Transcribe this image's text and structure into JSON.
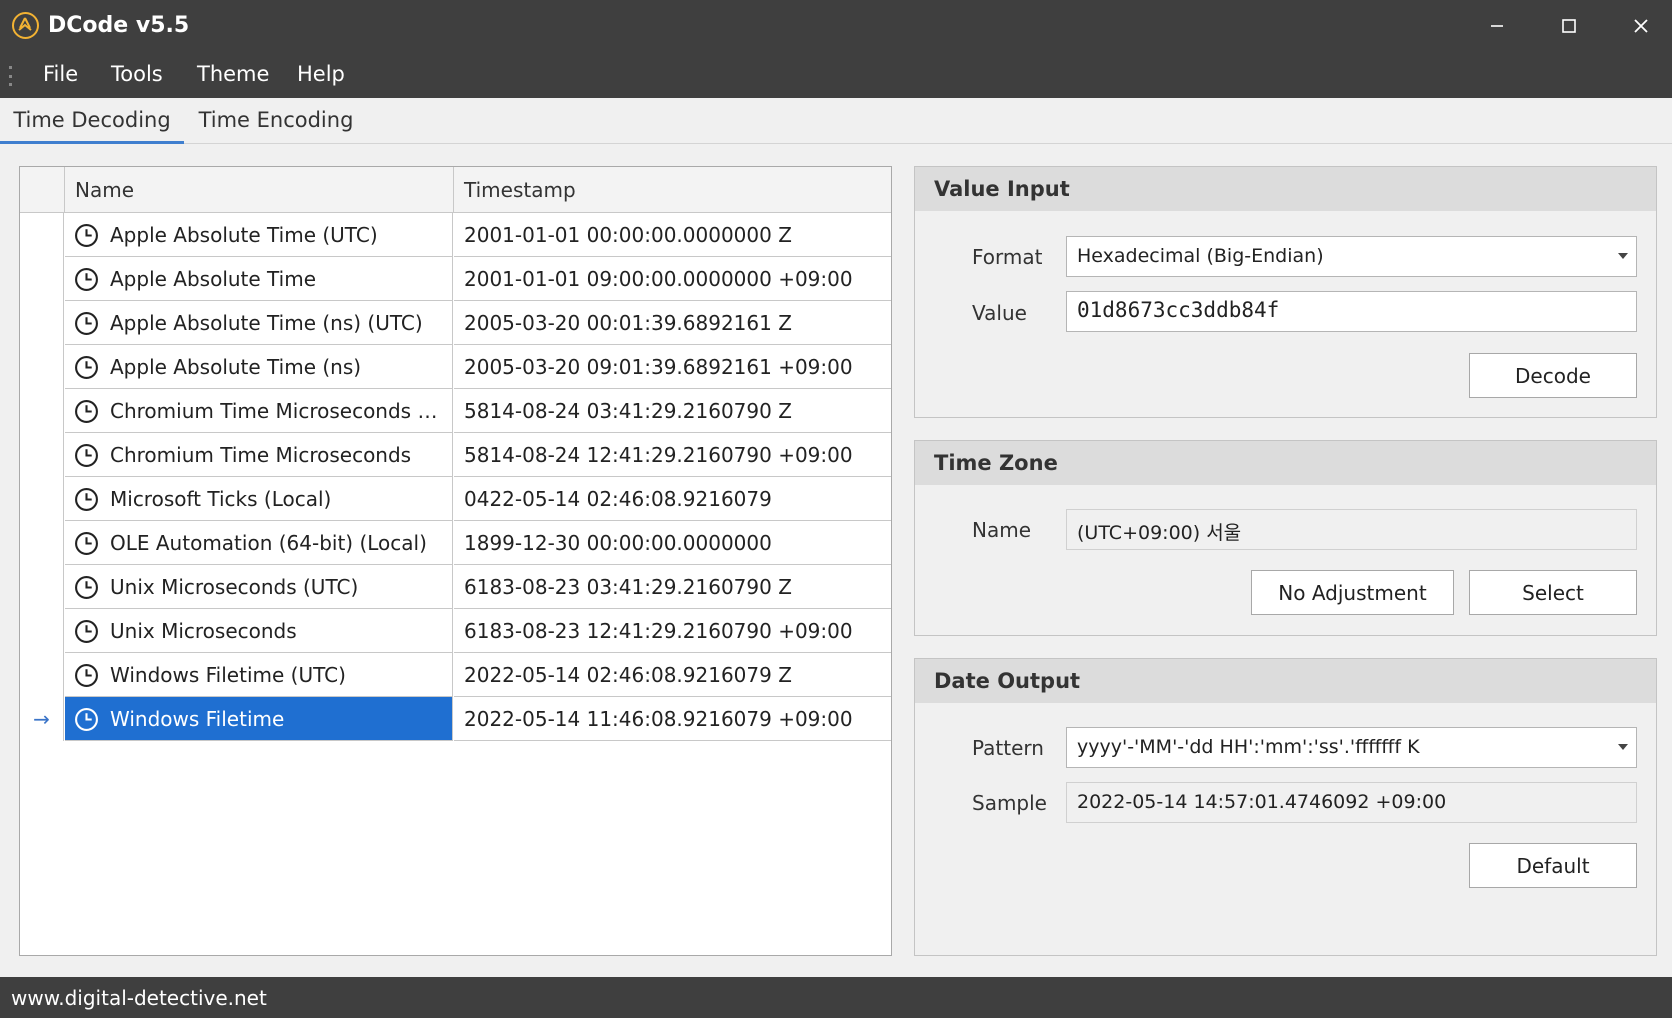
{
  "window": {
    "title": "DCode v5.5",
    "icon": "dcode-logo-icon",
    "controls": [
      "minimize-icon",
      "maximize-icon",
      "close-icon"
    ]
  },
  "menu": {
    "items": [
      "File",
      "Tools",
      "Theme",
      "Help"
    ]
  },
  "tabs": {
    "items": [
      "Time Decoding",
      "Time Encoding"
    ],
    "active": "Time Decoding"
  },
  "grid": {
    "columns": [
      "Name",
      "Timestamp"
    ],
    "rows": [
      {
        "name": "Apple Absolute Time (UTC)",
        "timestamp": "2001-01-01 00:00:00.0000000 Z"
      },
      {
        "name": "Apple Absolute Time",
        "timestamp": "2001-01-01 09:00:00.0000000 +09:00"
      },
      {
        "name": "Apple Absolute Time (ns) (UTC)",
        "timestamp": "2005-03-20 00:01:39.6892161 Z"
      },
      {
        "name": "Apple Absolute Time (ns)",
        "timestamp": "2005-03-20 09:01:39.6892161 +09:00"
      },
      {
        "name": "Chromium Time Microseconds (U...",
        "timestamp": "5814-08-24 03:41:29.2160790 Z"
      },
      {
        "name": "Chromium Time Microseconds",
        "timestamp": "5814-08-24 12:41:29.2160790 +09:00"
      },
      {
        "name": "Microsoft Ticks (Local)",
        "timestamp": "0422-05-14 02:46:08.9216079"
      },
      {
        "name": "OLE Automation (64-bit) (Local)",
        "timestamp": "1899-12-30 00:00:00.0000000"
      },
      {
        "name": "Unix Microseconds (UTC)",
        "timestamp": "6183-08-23 03:41:29.2160790 Z"
      },
      {
        "name": "Unix Microseconds",
        "timestamp": "6183-08-23 12:41:29.2160790 +09:00"
      },
      {
        "name": "Windows Filetime (UTC)",
        "timestamp": "2022-05-14 02:46:08.9216079 Z"
      },
      {
        "name": "Windows Filetime",
        "timestamp": "2022-05-14 11:46:08.9216079 +09:00"
      }
    ],
    "selected_row": 11,
    "row_icon": "clock-icon",
    "current_row_marker": "→"
  },
  "value_input": {
    "title": "Value Input",
    "format_label": "Format",
    "format_value": "Hexadecimal (Big-Endian)",
    "value_label": "Value",
    "value": "01d8673cc3ddb84f",
    "decode_label": "Decode"
  },
  "time_zone": {
    "title": "Time Zone",
    "name_label": "Name",
    "name_value": "(UTC+09:00) 서울",
    "no_adjustment_label": "No Adjustment",
    "select_label": "Select"
  },
  "date_output": {
    "title": "Date Output",
    "pattern_label": "Pattern",
    "pattern_value": "yyyy'-'MM'-'dd HH':'mm':'ss'.'fffffff K",
    "sample_label": "Sample",
    "sample_value": "2022-05-14 14:57:01.4746092 +09:00",
    "default_label": "Default"
  },
  "status": {
    "text": "www.digital-detective.net"
  },
  "colors": {
    "chrome": "#3f3f3f",
    "selection": "#1f6fd1",
    "accent": "#3f7fcf",
    "logo": "#f2b233"
  }
}
